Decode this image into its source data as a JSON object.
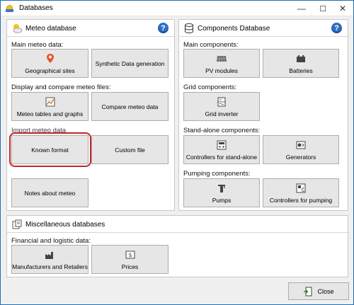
{
  "window": {
    "title": "Databases",
    "minimize_glyph": "—",
    "maximize_glyph": "☐",
    "close_glyph": "✕"
  },
  "meteo": {
    "title": "Meteo database",
    "help": "?",
    "main_label": "Main meteo data:",
    "geo_sites": "Geographical sites",
    "synthetic": "Synthetic Data generation",
    "display_label": "Display and compare meteo files:",
    "tables_graphs": "Meteo tables and graphs",
    "compare": "Compare meteo data",
    "import_label": "Import meteo data",
    "known_format": "Known format",
    "custom_file": "Custom file",
    "notes": "Notes about meteo"
  },
  "components": {
    "title": "Components Database",
    "help": "?",
    "main_label": "Main components:",
    "pv_modules": "PV modules",
    "batteries": "Batteries",
    "grid_label": "Grid components:",
    "grid_inverter": "Grid inverter",
    "standalone_label": "Stand-alone components:",
    "controllers_standalone": "Controllers for stand-alone",
    "generators": "Generators",
    "pumping_label": "Pumping components:",
    "pumps": "Pumps",
    "controllers_pumping": "Controllers for pumping"
  },
  "misc": {
    "title": "Miscellaneous databases",
    "financial_label": "Financial and logistic data:",
    "manufacturers": "Manufacturers and Retailers",
    "prices": "Prices"
  },
  "footer": {
    "close": "Close"
  },
  "colors": {
    "highlight": "#c0282b",
    "help_blue": "#2c6fc2",
    "window_border": "#1f6fb8"
  }
}
